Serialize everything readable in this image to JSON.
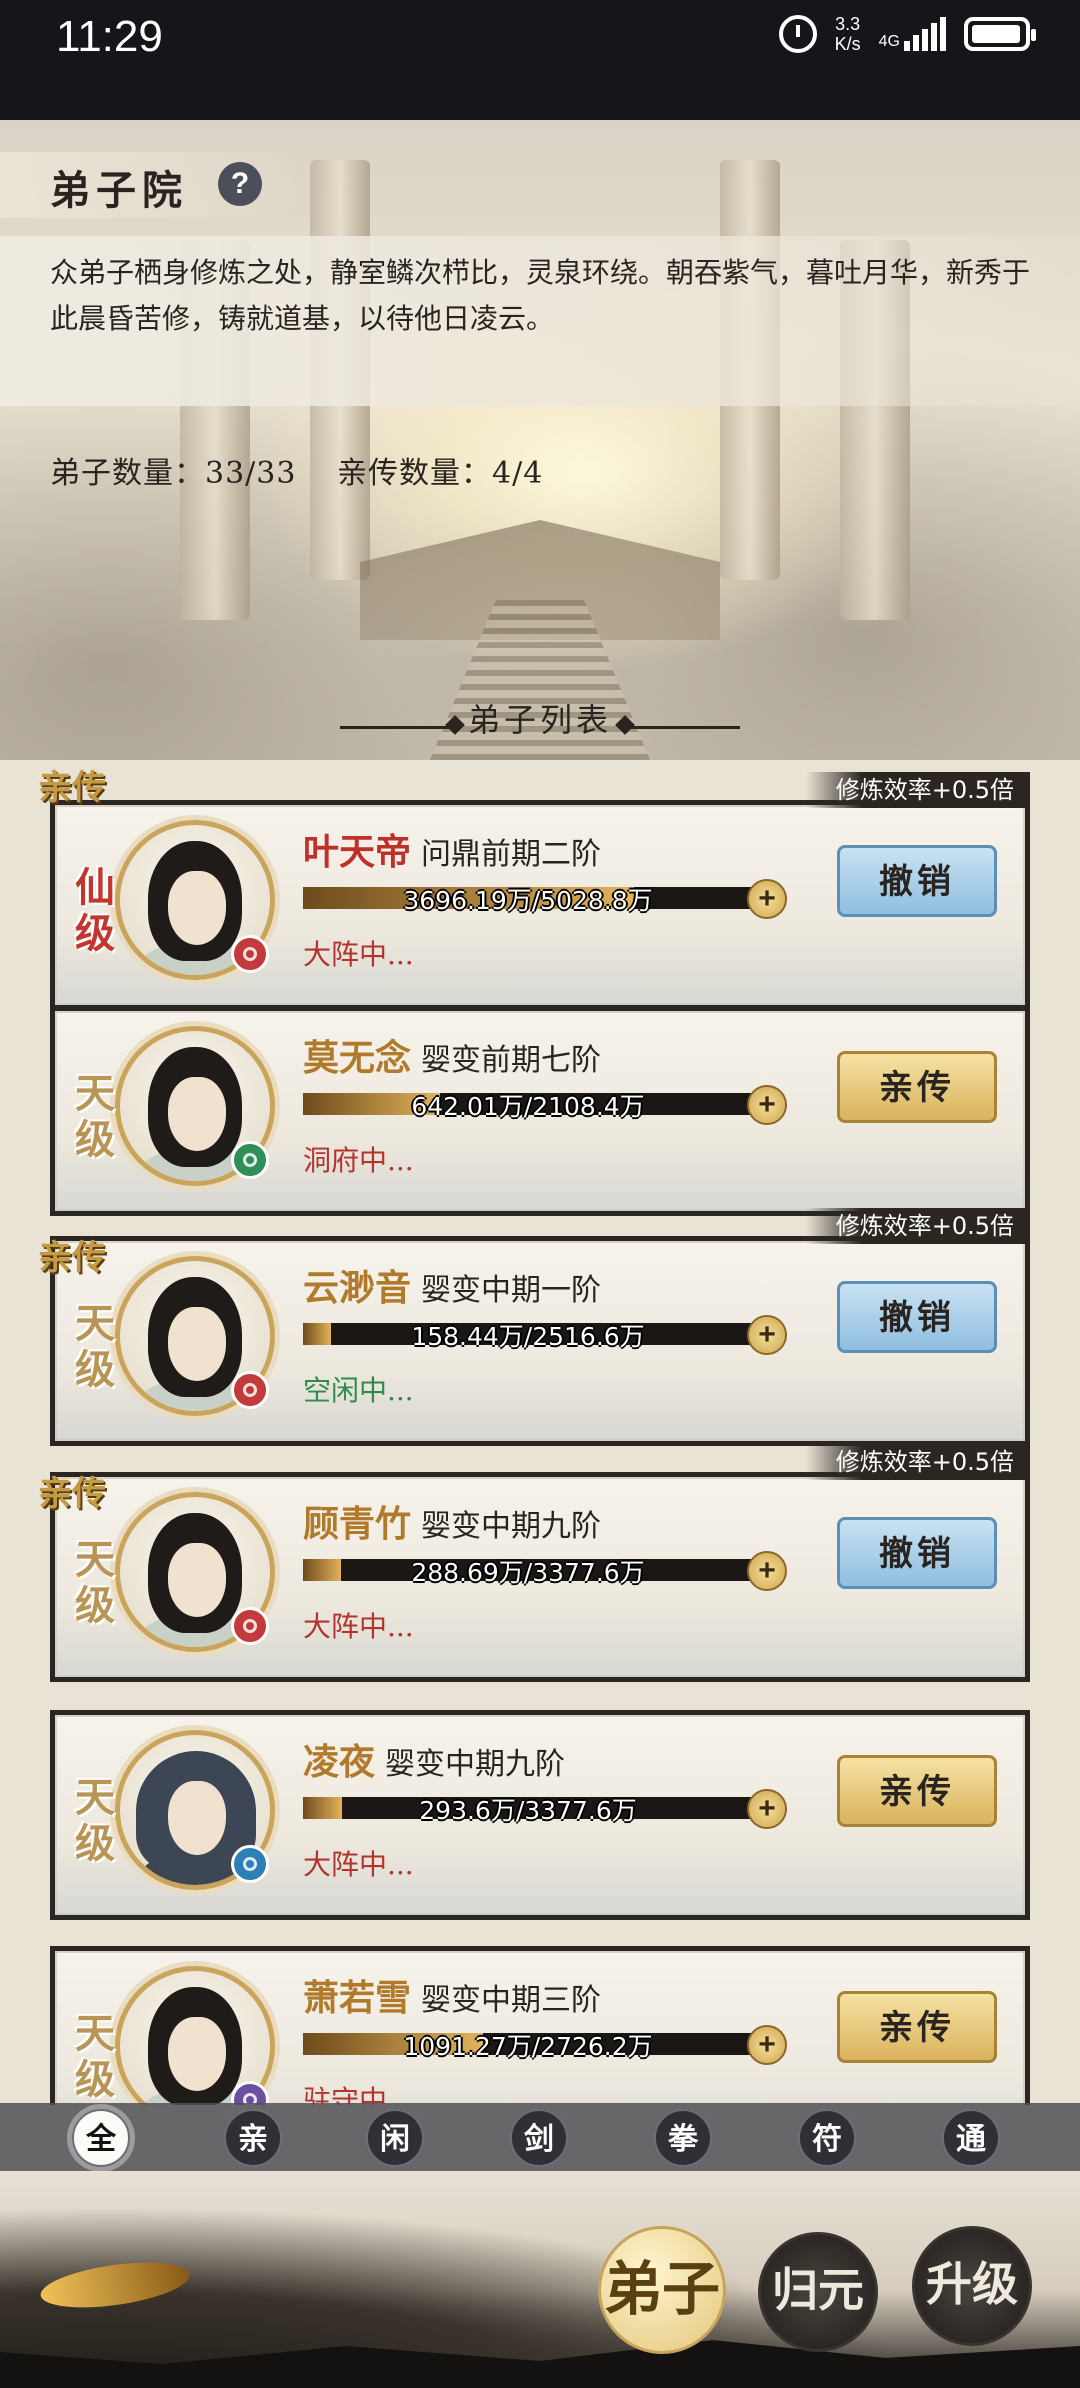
{
  "status_bar": {
    "time": "11:29",
    "speed_value": "3.3",
    "speed_unit": "K/s",
    "network": "4G"
  },
  "header": {
    "title": "弟子院",
    "help_label": "?",
    "description": "众弟子栖身修炼之处，静室鳞次栉比，灵泉环绕。朝吞紫气，暮吐月华，新秀于此晨昏苦修，铸就道基，以待他日凌云。",
    "disciple_count": "弟子数量：33/33",
    "core_count": "亲传数量：4/4"
  },
  "list_title": "弟子列表",
  "disciples": [
    {
      "tag": "亲传",
      "bonus": "修炼效率+0.5倍",
      "grade": "仙级",
      "element": "fire-element-icon",
      "name": "叶天帝",
      "realm": "问鼎前期二阶",
      "progress_text": "3696.19万/5028.8万",
      "progress": 0.735,
      "status": "大阵中...",
      "action": "撤销"
    },
    {
      "tag": "",
      "bonus": "",
      "grade": "天级",
      "element": "wind-element-icon",
      "name": "莫无念",
      "realm": "婴变前期七阶",
      "progress_text": "642.01万/2108.4万",
      "progress": 0.305,
      "status": "洞府中...",
      "action": "亲传"
    },
    {
      "tag": "亲传",
      "bonus": "修炼效率+0.5倍",
      "grade": "天级",
      "element": "fire-element-icon",
      "name": "云渺音",
      "realm": "婴变中期一阶",
      "progress_text": "158.44万/2516.6万",
      "progress": 0.063,
      "status": "空闲中...",
      "action": "撤销"
    },
    {
      "tag": "亲传",
      "bonus": "修炼效率+0.5倍",
      "grade": "天级",
      "element": "fire-element-icon",
      "name": "顾青竹",
      "realm": "婴变中期九阶",
      "progress_text": "288.69万/3377.6万",
      "progress": 0.085,
      "status": "大阵中...",
      "action": "撤销"
    },
    {
      "tag": "",
      "bonus": "",
      "grade": "天级",
      "element": "water-element-icon",
      "name": "凌夜",
      "realm": "婴变中期九阶",
      "progress_text": "293.6万/3377.6万",
      "progress": 0.087,
      "status": "大阵中...",
      "action": "亲传"
    },
    {
      "tag": "",
      "bonus": "",
      "grade": "天级",
      "element": "element-icon",
      "name": "萧若雪",
      "realm": "婴变中期三阶",
      "progress_text": "1091.27万/2726.2万",
      "progress": 0.4,
      "status": "驻守中...",
      "action": "亲传"
    }
  ],
  "filters": [
    "全",
    "亲",
    "闲",
    "剑",
    "拳",
    "符",
    "通"
  ],
  "bottom_nav": {
    "main": "弟子",
    "return_label": "归元",
    "upgrade_label": "升级"
  },
  "colors": {
    "revoke_button": "#8fbedf",
    "promote_button": "#d9b35e",
    "name_red": "#c0302a",
    "name_gold": "#b07a2a"
  }
}
